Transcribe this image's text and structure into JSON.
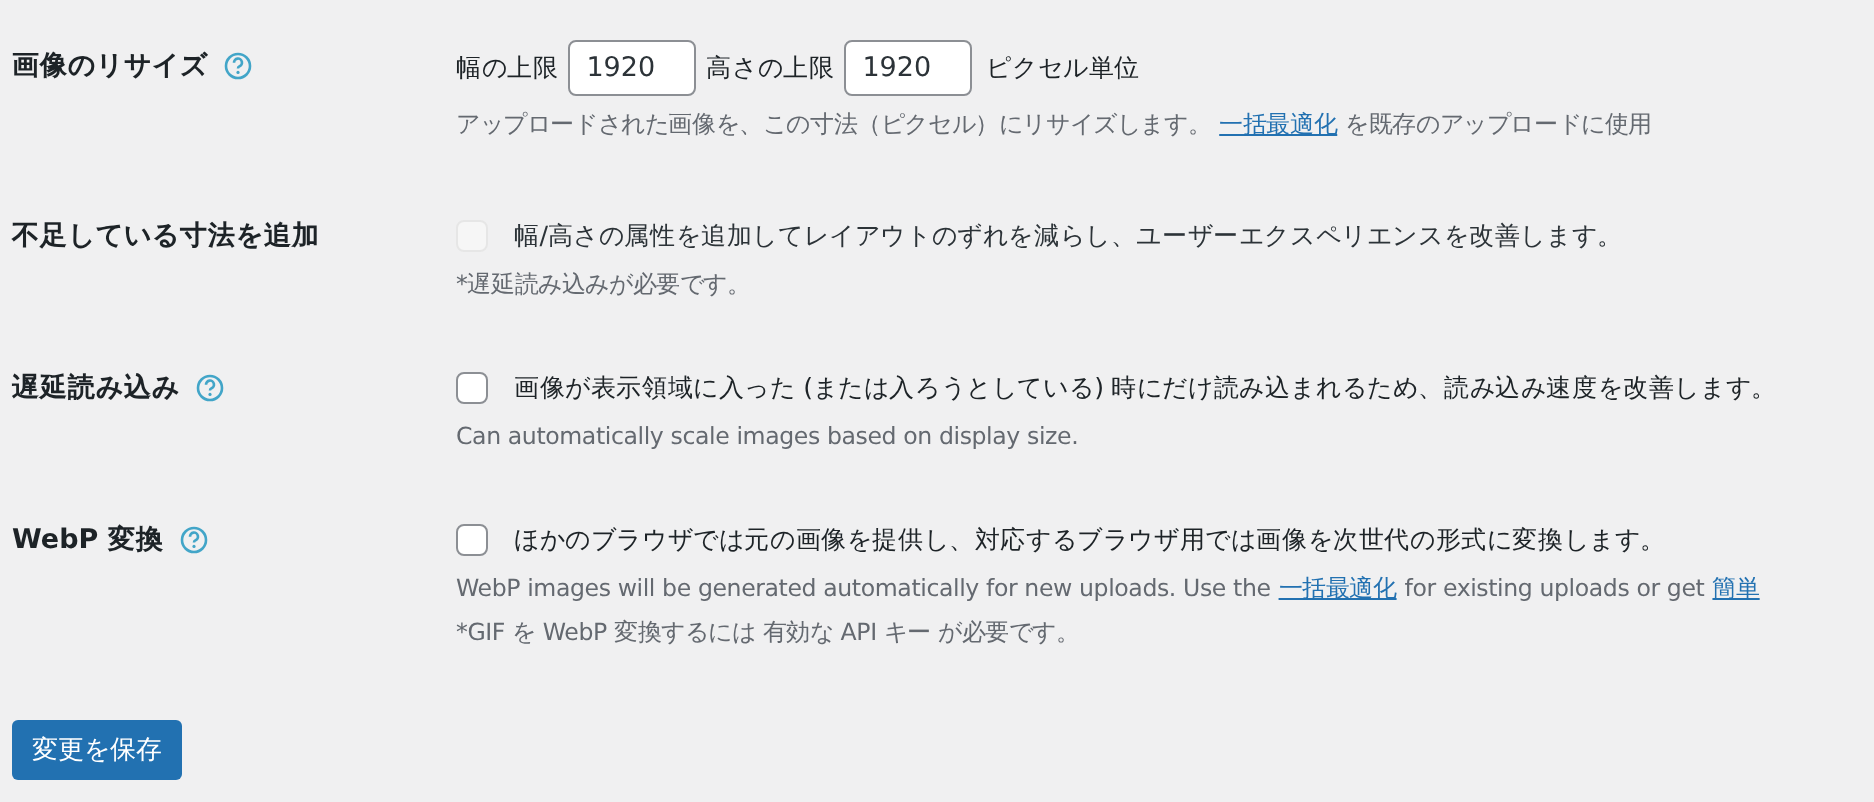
{
  "settings": [
    {
      "kind": "dimensions",
      "label": "画像のリサイズ",
      "help": true,
      "fields": [
        {
          "label": "幅の上限",
          "value": "1920"
        },
        {
          "label": "高さの上限",
          "value": "1920"
        }
      ],
      "unit": "ピクセル単位",
      "notes": [
        [
          {
            "kind": "text",
            "text": "アップロードされた画像を、この寸法（ピクセル）にリサイズします。"
          },
          {
            "kind": "link",
            "text": "一括最適化"
          },
          {
            "kind": "text",
            "text": "を既存のアップロードに使用"
          }
        ]
      ]
    },
    {
      "kind": "checkbox",
      "label": "不足している寸法を追加",
      "help": false,
      "checked": false,
      "disabled": true,
      "text": "幅/高さの属性を追加してレイアウトのずれを減らし、ユーザーエクスペリエンスを改善します。",
      "notes": [
        [
          {
            "kind": "text",
            "text": "*遅延読み込みが必要です。"
          }
        ]
      ]
    },
    {
      "kind": "checkbox",
      "label": "遅延読み込み",
      "help": true,
      "checked": false,
      "disabled": false,
      "text": "画像が表示領域に入った (または入ろうとしている) 時にだけ読み込まれるため、読み込み速度を改善します。",
      "notes": [
        [
          {
            "kind": "text",
            "text": "Can automatically scale images based on display size."
          }
        ]
      ]
    },
    {
      "kind": "checkbox",
      "label": "WebP 変換",
      "help": true,
      "checked": false,
      "disabled": false,
      "text": "ほかのブラウザでは元の画像を提供し、対応するブラウザ用では画像を次世代の形式に変換します。",
      "notes": [
        [
          {
            "kind": "text",
            "text": "WebP images will be generated automatically for new uploads. Use the"
          },
          {
            "kind": "link",
            "text": "一括最適化"
          },
          {
            "kind": "text",
            "text": "for existing uploads or get"
          },
          {
            "kind": "link",
            "text": "簡単"
          }
        ],
        [
          {
            "kind": "text",
            "text": "*GIF を WebP 変換するには 有効な API キー が必要です。"
          }
        ]
      ]
    }
  ],
  "save_button": "変更を保存"
}
